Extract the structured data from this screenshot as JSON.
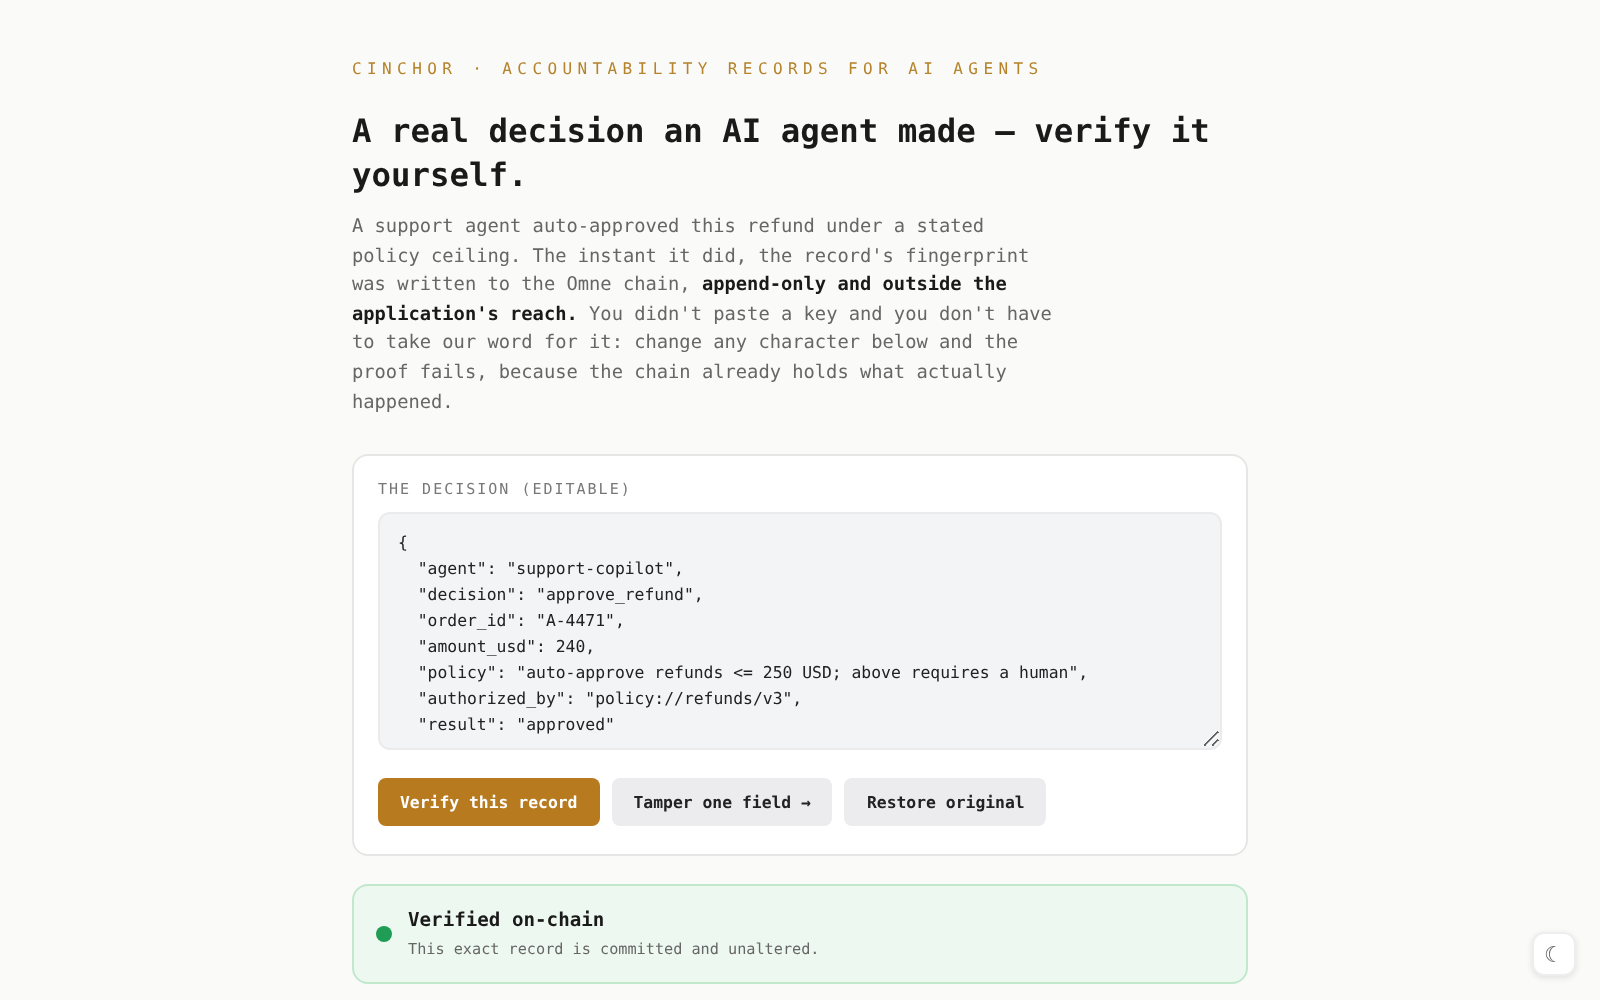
{
  "eyebrow": "CINCHOR · ACCOUNTABILITY RECORDS FOR AI AGENTS",
  "heading": "A real decision an AI agent made — verify it yourself.",
  "intro": "A support agent auto-approved this refund under a stated policy ceiling. The instant it did, the record's fingerprint was written to the Omne chain, **append-only and outside the application's reach.** You didn't paste a key and you don't have to take our word for it: change any character below and the proof fails, because the chain already holds what actually happened.",
  "decision": {
    "label": "THE DECISION (EDITABLE)",
    "lines": [
      "{",
      "  \"agent\": \"support-copilot\",",
      "  \"decision\": \"approve_refund\",",
      "  \"order_id\": \"A-4471\",",
      "  \"amount_usd\": 240,",
      "  \"policy\": \"auto-approve refunds <= 250 USD; above requires a human\",",
      "  \"authorized_by\": \"policy://refunds/v3\",",
      "  \"result\": \"approved\""
    ],
    "buttons": [
      {
        "label": "Verify this record",
        "kind": "primary"
      },
      {
        "label": "Tamper one field →",
        "kind": "secondary"
      },
      {
        "label": "Restore original",
        "kind": "secondary"
      }
    ]
  },
  "status": {
    "kind": "verified",
    "color": "#1f9d55",
    "title": "Verified on-chain",
    "detail": "This exact record is committed and unaltered."
  },
  "theme_toggle": {
    "icon": "☾"
  }
}
